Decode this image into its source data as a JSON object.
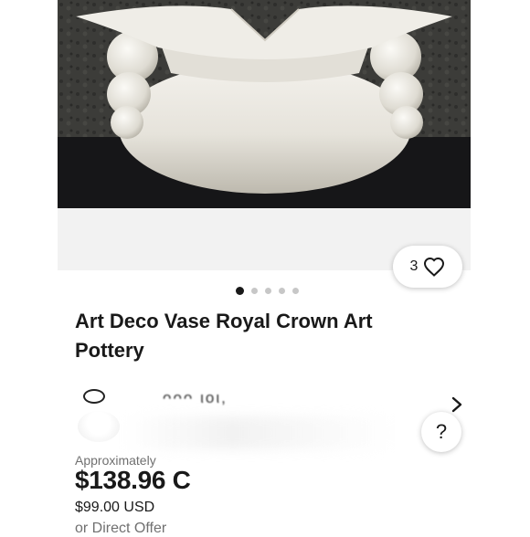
{
  "listing": {
    "title": "Art Deco Vase Royal Crown Art Pottery",
    "watch_count": "3",
    "image_count": 5,
    "active_image_index": 0
  },
  "seller": {
    "name_partial": "ᴖᴖᴖ ιοι,"
  },
  "help": {
    "label": "?"
  },
  "price": {
    "approx_label": "Approximately",
    "converted": "$138.96 C",
    "original": "$99.00 USD",
    "offer_text": "or Direct Offer"
  },
  "colors": {
    "text_primary": "#191919",
    "text_secondary": "#707070",
    "photo_wall": "#3a3a38",
    "photo_table": "#161618",
    "vase": "#e9e7e0"
  },
  "icons": {
    "watch": "heart-icon",
    "seller_nav": "chevron-right-icon",
    "help": "question-icon"
  }
}
